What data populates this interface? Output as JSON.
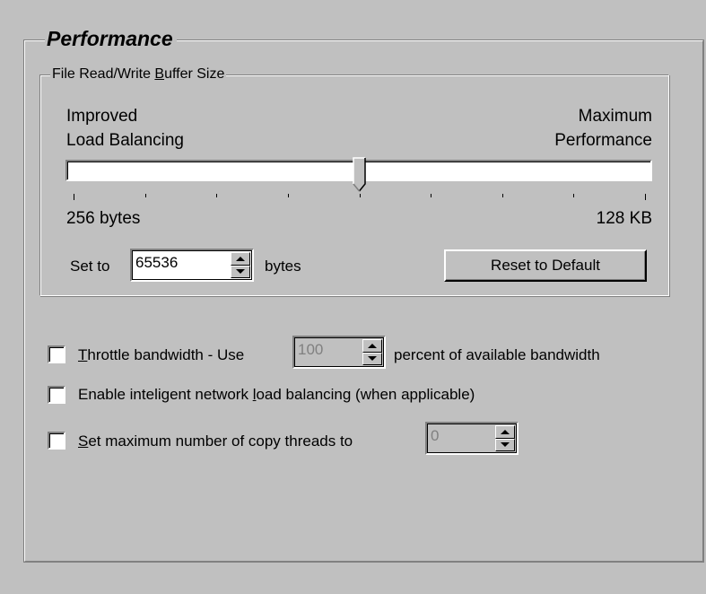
{
  "performance_group": {
    "title": "Performance"
  },
  "buffer_group": {
    "title_pre": "File Read/Write ",
    "title_accel": "B",
    "title_post": "uffer Size",
    "left_label_line1": "Improved",
    "left_label_line2": "Load Balancing",
    "right_label_line1": "Maximum",
    "right_label_line2": "Performance",
    "min_label": "256 bytes",
    "max_label": "128 KB",
    "slider_position_fraction": 0.5,
    "tick_count": 9,
    "set_to_label": "Set to",
    "set_to_value": "65536",
    "units_label": "bytes",
    "reset_button_label": "Reset to Default"
  },
  "options": {
    "throttle": {
      "checked": false,
      "label_accel": "T",
      "label_pre": "hrottle bandwidth - Use",
      "value": "100",
      "label_post": "percent of available bandwidth"
    },
    "load_balancing": {
      "checked": false,
      "label_pre": "Enable inteligent network ",
      "label_accel": "l",
      "label_post": "oad balancing (when applicable)"
    },
    "copy_threads": {
      "checked": false,
      "label_accel": "S",
      "label_pre": "et maximum number of copy threads to",
      "value": "0"
    }
  }
}
